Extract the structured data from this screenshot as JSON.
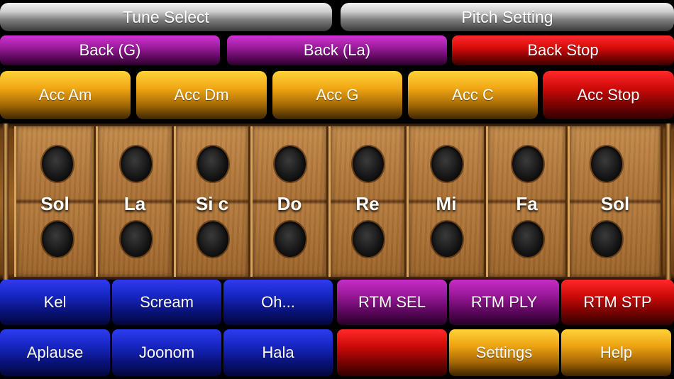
{
  "top_row": {
    "tune_select": "Tune Select",
    "pitch_setting": "Pitch Setting"
  },
  "back_row": {
    "back_g": "Back (G)",
    "back_la": "Back (La)",
    "back_stop": "Back Stop"
  },
  "acc_row": {
    "acc_am": "Acc Am",
    "acc_dm": "Acc Dm",
    "acc_g": "Acc G",
    "acc_c": "Acc C",
    "acc_stop": "Acc Stop"
  },
  "keys": [
    {
      "label": "Sol"
    },
    {
      "label": "La"
    },
    {
      "label": "Si c"
    },
    {
      "label": "Do"
    },
    {
      "label": "Re"
    },
    {
      "label": "Mi"
    },
    {
      "label": "Fa"
    },
    {
      "label": "Sol"
    }
  ],
  "sound_row": {
    "kel": "Kel",
    "scream": "Scream",
    "oh": "Oh...",
    "rtm_sel": "RTM SEL",
    "rtm_ply": "RTM PLY",
    "rtm_stp": "RTM STP"
  },
  "bottom_row": {
    "aplause": "Aplause",
    "joonom": "Joonom",
    "hala": "Hala",
    "blank": "",
    "settings": "Settings",
    "help": "Help"
  },
  "colors": {
    "silver": "#cfcfcf",
    "magenta": "#9b1b9b",
    "red": "#d80c0c",
    "gold": "#f1a814",
    "blue": "#1726c2",
    "wood": "#a96f33"
  }
}
